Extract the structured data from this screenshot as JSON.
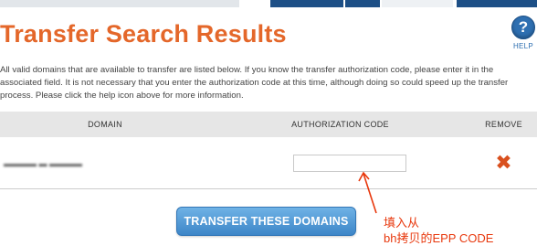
{
  "page": {
    "title": "Transfer Search Results",
    "help_label": "HELP",
    "help_symbol": "?",
    "intro": "All valid domains that are available to transfer are listed below. If you know the transfer authorization code, please enter it in the associated field. It is not necessary that you enter the authorization code at this time, although doing so could speed up the transfer process. Please click the help icon above for more information."
  },
  "table": {
    "headers": [
      "DOMAIN",
      "AUTHORIZATION CODE",
      "REMOVE"
    ],
    "rows": [
      {
        "domain": "▬▬▬▬ ▬ ▬▬▬▬",
        "auth_code": "",
        "remove_icon": "close-x"
      }
    ]
  },
  "actions": {
    "transfer_label": "TRANSFER THESE DOMAINS"
  },
  "annotation": {
    "line1": "填入从",
    "line2": "bh拷贝的EPP CODE",
    "color": "#e8380d"
  },
  "colors": {
    "title": "#e4672a",
    "help": "#2e6fb1",
    "button": "#4a90d2",
    "remove": "#d9501e",
    "nav": "#1d4f86"
  }
}
